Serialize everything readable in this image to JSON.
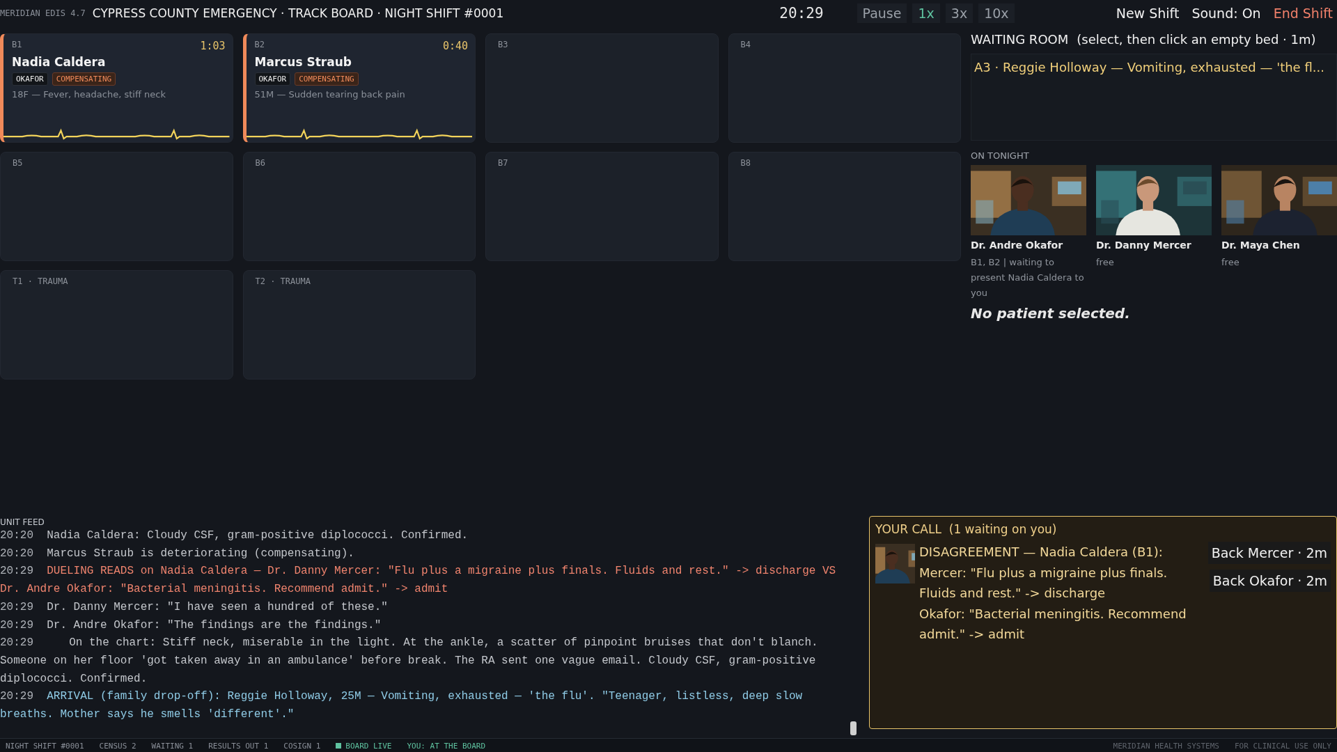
{
  "top_bar": {
    "version": "MERIDIAN EDIS 4.7",
    "title": "CYPRESS COUNTY EMERGENCY · TRACK BOARD · NIGHT SHIFT #0001",
    "clock": "20:29",
    "pause": "Pause",
    "speeds": [
      {
        "label": "1x",
        "selected": true
      },
      {
        "label": "3x",
        "selected": false
      },
      {
        "label": "10x",
        "selected": false
      }
    ],
    "actions": [
      {
        "label": "New Shift",
        "kind": "plain"
      },
      {
        "label": "Sound: On",
        "kind": "plain"
      },
      {
        "label": "End Shift",
        "kind": "danger"
      }
    ]
  },
  "beds": [
    {
      "label": "B1",
      "occupied": true,
      "timer": "1:03",
      "patient": "Nadia Caldera",
      "doctor": "OKAFOR",
      "status": "COMPENSATING",
      "complaint": "18F — Fever, headache, stiff neck"
    },
    {
      "label": "B2",
      "occupied": true,
      "timer": "0:40",
      "patient": "Marcus Straub",
      "doctor": "OKAFOR",
      "status": "COMPENSATING",
      "complaint": "51M — Sudden tearing back pain"
    },
    {
      "label": "B3",
      "occupied": false
    },
    {
      "label": "B4",
      "occupied": false
    },
    {
      "label": "B5",
      "occupied": false
    },
    {
      "label": "B6",
      "occupied": false
    },
    {
      "label": "B7",
      "occupied": false
    },
    {
      "label": "B8",
      "occupied": false
    },
    {
      "label": "T1 · TRAUMA",
      "occupied": false
    },
    {
      "label": "T2 · TRAUMA",
      "occupied": false
    }
  ],
  "waiting_room": {
    "title": "WAITING ROOM",
    "hint": "(select, then click an empty bed · 1m)",
    "patients": [
      {
        "text": "A3 · Reggie Holloway — Vomiting, exhausted — 'the fl...",
        "selected": false
      }
    ]
  },
  "on_tonight": {
    "title": "ON TONIGHT",
    "doctors": [
      {
        "name": "Dr. Andre Okafor",
        "status": "B1, B2 | waiting to present Nadia Caldera to you",
        "picture": {
          "kind": "picture"
        }
      },
      {
        "name": "Dr. Danny Mercer",
        "status": "free",
        "picture": {
          "kind": "picture"
        }
      },
      {
        "name": "Dr. Maya Chen",
        "status": "free",
        "picture": {
          "kind": "picture"
        }
      }
    ]
  },
  "selection": "No patient selected.",
  "unit_feed": {
    "title": "UNIT FEED",
    "entries": [
      {
        "time": "20:20",
        "kind": "normal",
        "text": "Nadia Caldera: Cloudy CSF, gram-positive diplococci. Confirmed."
      },
      {
        "time": "20:20",
        "kind": "normal",
        "text": "Marcus Straub is deteriorating (compensating)."
      },
      {
        "time": "20:29",
        "kind": "alert",
        "text": "DUELING READS on Nadia Caldera — Dr. Danny Mercer: \"Flu plus a migraine plus finals. Fluids and rest.\" -> discharge  VS Dr. Andre Okafor: \"Bacterial meningitis. Recommend admit.\" -> admit"
      },
      {
        "time": "20:29",
        "kind": "normal",
        "text": "Dr. Danny Mercer: \"I have seen a hundred of these.\""
      },
      {
        "time": "20:29",
        "kind": "normal",
        "text": "Dr. Andre Okafor: \"The findings are the findings.\""
      },
      {
        "time": "20:29",
        "kind": "chart",
        "text": "On the chart: Stiff neck, miserable in the light. At the ankle, a scatter of pinpoint bruises that don't blanch. Someone on her floor 'got taken away in an ambulance' before break. The RA sent one vague email. Cloudy CSF, gram-positive diplococci. Confirmed."
      },
      {
        "time": "20:29",
        "kind": "arrival",
        "text": "ARRIVAL (family drop-off): Reggie Holloway, 25M — Vomiting, exhausted — 'the flu'. \"Teenager, listless, deep slow breaths. Mother says he smells 'different'.\""
      }
    ]
  },
  "your_call": {
    "title": "YOUR CALL  (1 waiting on you)",
    "headline": "DISAGREEMENT — Nadia Caldera (B1):",
    "picture": {
      "kind": "picture"
    },
    "lines": [
      "Mercer: \"Flu plus a migraine plus finals. Fluids and rest.\" -> discharge",
      "Okafor: \"Bacterial meningitis. Recommend admit.\" -> admit"
    ],
    "buttons": [
      "Back Mercer · 2m",
      "Back Okafor · 2m"
    ]
  },
  "status_bar": {
    "items": [
      {
        "text": "NIGHT SHIFT #0001",
        "kind": "plain"
      },
      {
        "text": "CENSUS 2",
        "kind": "plain"
      },
      {
        "text": "WAITING 1",
        "kind": "plain"
      },
      {
        "text": "RESULTS OUT 1",
        "kind": "plain"
      },
      {
        "text": "COSIGN 1",
        "kind": "plain"
      },
      {
        "text": "BOARD LIVE",
        "kind": "live"
      },
      {
        "text": "YOU: AT THE BOARD",
        "kind": "accent"
      }
    ],
    "right": [
      "MERIDIAN HEALTH SYSTEMS",
      "FOR CLINICAL USE ONLY"
    ]
  }
}
